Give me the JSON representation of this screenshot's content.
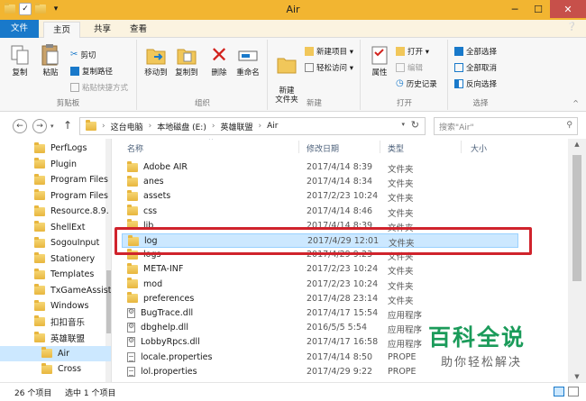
{
  "window": {
    "title": "Air"
  },
  "tabs": {
    "file": "文件",
    "home": "主页",
    "share": "共享",
    "view": "查看"
  },
  "ribbon": {
    "clipboard": {
      "label": "剪贴板",
      "copy": "复制",
      "paste": "粘贴",
      "cut": "剪切",
      "copy_path": "复制路径",
      "paste_shortcut": "粘贴快捷方式"
    },
    "organize": {
      "label": "组织",
      "move_to": "移动到",
      "copy_to": "复制到",
      "delete": "删除",
      "rename": "重命名"
    },
    "new": {
      "label": "新建",
      "new_folder": "新建\n文件夹",
      "new_item": "新建项目 ▾",
      "easy_access": "轻松访问 ▾"
    },
    "open": {
      "label": "打开",
      "properties": "属性",
      "open": "打开 ▾",
      "edit": "编辑",
      "history": "历史记录"
    },
    "select": {
      "label": "选择",
      "select_all": "全部选择",
      "select_none": "全部取消",
      "invert": "反向选择"
    }
  },
  "address": {
    "crumbs": [
      "这台电脑",
      "本地磁盘 (E:)",
      "英雄联盟",
      "Air"
    ],
    "search_placeholder": "搜索\"Air\""
  },
  "nav": {
    "items": [
      "PerfLogs",
      "Plugin",
      "Program Files",
      "Program Files",
      "Resource.8.9.",
      "ShellExt",
      "SogouInput",
      "Stationery",
      "Templates",
      "TxGameAssist",
      "Windows",
      "扣扣音乐",
      "英雄联盟",
      "Air",
      "Cross"
    ],
    "selected_index": 13
  },
  "columns": {
    "name": "名称",
    "date": "修改日期",
    "type": "类型",
    "size": "大小"
  },
  "files": [
    {
      "name": "Adobe AIR",
      "date": "2017/4/14 8:39",
      "type": "文件夹",
      "icon": "folder"
    },
    {
      "name": "anes",
      "date": "2017/4/14 8:34",
      "type": "文件夹",
      "icon": "folder"
    },
    {
      "name": "assets",
      "date": "2017/2/23 10:24",
      "type": "文件夹",
      "icon": "folder"
    },
    {
      "name": "css",
      "date": "2017/4/14 8:46",
      "type": "文件夹",
      "icon": "folder"
    },
    {
      "name": "lib",
      "date": "2017/4/14 8:39",
      "type": "文件夹",
      "icon": "folder"
    },
    {
      "name": "log",
      "date": "2017/4/29 12:01",
      "type": "文件夹",
      "icon": "folder",
      "selected": true
    },
    {
      "name": "logs",
      "date": "2017/4/29 9:23",
      "type": "文件夹",
      "icon": "folder"
    },
    {
      "name": "META-INF",
      "date": "2017/2/23 10:24",
      "type": "文件夹",
      "icon": "folder"
    },
    {
      "name": "mod",
      "date": "2017/2/23 10:24",
      "type": "文件夹",
      "icon": "folder"
    },
    {
      "name": "preferences",
      "date": "2017/4/28 23:14",
      "type": "文件夹",
      "icon": "folder"
    },
    {
      "name": "BugTrace.dll",
      "date": "2017/4/17 15:54",
      "type": "应用程序",
      "icon": "gear"
    },
    {
      "name": "dbghelp.dll",
      "date": "2016/5/5 5:54",
      "type": "应用程序",
      "icon": "gear"
    },
    {
      "name": "LobbyRpcs.dll",
      "date": "2017/4/17 16:58",
      "type": "应用程序",
      "icon": "gear"
    },
    {
      "name": "locale.properties",
      "date": "2017/4/14 8:50",
      "type": "PROPE",
      "icon": "txt"
    },
    {
      "name": "lol.properties",
      "date": "2017/4/29 9:22",
      "type": "PROPE",
      "icon": "txt"
    }
  ],
  "status": {
    "count": "26 个项目",
    "selected": "选中 1 个项目"
  },
  "watermark": {
    "line1": "百科全说",
    "line2": "助你轻松解决"
  },
  "colors": {
    "accent": "#1979ca",
    "titlebar": "#f2b531",
    "highlight": "#d0232c",
    "selection": "#cce8ff"
  }
}
